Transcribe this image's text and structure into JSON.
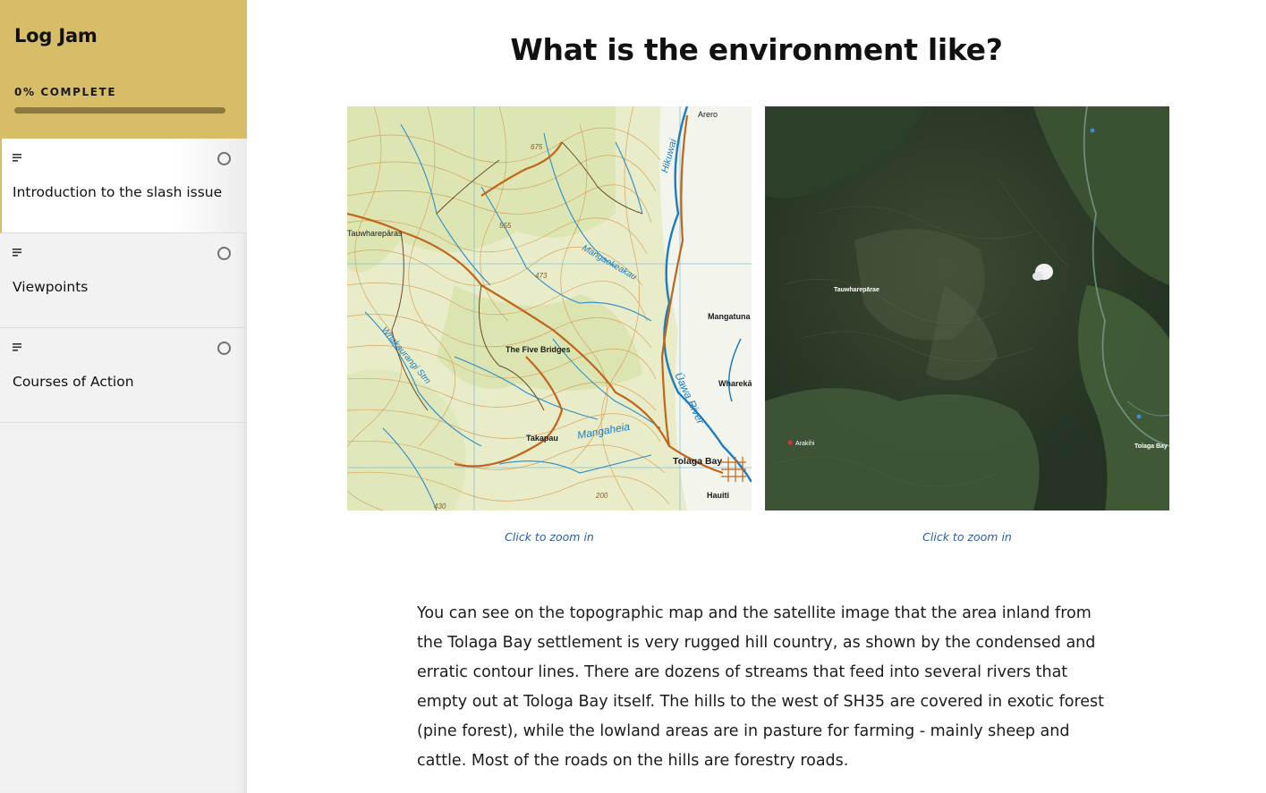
{
  "sidebar": {
    "course_title": "Log Jam",
    "progress_label": "0% COMPLETE",
    "progress_fraction": 0,
    "lessons": [
      {
        "label": "Introduction to the slash issue",
        "icon": "text-lines-icon",
        "status": "not-started",
        "active": true
      },
      {
        "label": "Viewpoints",
        "icon": "text-lines-icon",
        "status": "not-started",
        "active": false
      },
      {
        "label": "Courses of Action",
        "icon": "text-lines-icon",
        "status": "not-started",
        "active": false
      }
    ]
  },
  "main": {
    "title": "What is the environment like?",
    "images": [
      {
        "kind": "topographic-map",
        "caption": "Click to zoom in",
        "map_labels": {
          "arero": "Arero",
          "tauwharepar": "Tauwharepāras",
          "h675": "675",
          "h555": "555",
          "h473": "473",
          "h430": "430",
          "h200": "200",
          "mangatuna": "Mangatuna",
          "five_bridges": "The Five Bridges",
          "whareka": "Wharekā",
          "takapau": "Takapau",
          "tolaga_bay": "Tolaga Bay",
          "hauiti": "Hauiti",
          "hikuwai": "Hikuwai",
          "mangaokeakau": "Mangaokeakau",
          "uawa_river": "Ūawa River",
          "mangaheia": "Mangaheia",
          "whakaurangi": "Whakaurangi Stm"
        }
      },
      {
        "kind": "satellite-image",
        "caption": "Click to zoom in",
        "map_labels": {
          "tauwharepar": "Tauwharepārae",
          "arakihi": "Arakihi",
          "tolaga_bay": "Tolaga Bay"
        }
      }
    ],
    "body": "You can see on the topographic map and the satellite image that the area inland from the Tolaga Bay settlement is very rugged hill country, as shown by the condensed and erratic contour lines. There are dozens of streams that feed into several rivers that empty out at Tologa Bay itself. The hills to the west of SH35 are covered in exotic forest (pine forest), while the lowland areas are in pasture for farming - mainly sheep and cattle. Most of the roads on the hills are forestry roads."
  },
  "colors": {
    "sidebar_header": "#d8bd68",
    "progress_track": "#8e7a3f",
    "caption_link": "#2d5d9a"
  }
}
